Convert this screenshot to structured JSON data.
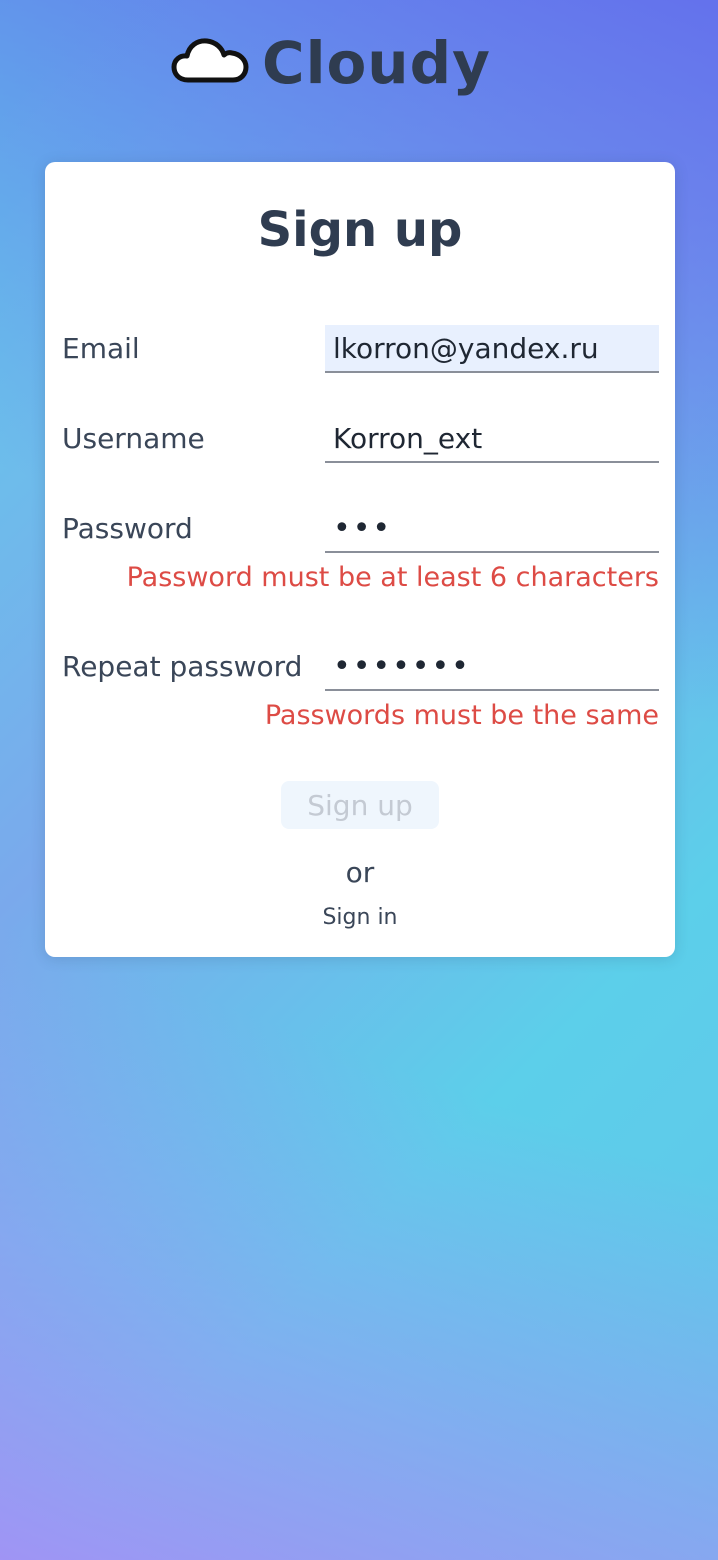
{
  "brand": {
    "name": "Cloudy",
    "icon": "cloud-icon"
  },
  "form": {
    "title": "Sign up",
    "fields": {
      "email": {
        "label": "Email",
        "value": "lkorron@yandex.ru"
      },
      "username": {
        "label": "Username",
        "value": "Korron_ext"
      },
      "password": {
        "label": "Password",
        "value": "•••",
        "error": "Password must be at least 6 characters"
      },
      "repeat_password": {
        "label": "Repeat password",
        "value": "•••••••",
        "error": "Passwords must be the same"
      }
    },
    "submit_label": "Sign up",
    "or_text": "or",
    "signin_link": "Sign in"
  },
  "colors": {
    "error": "#dd4b45",
    "text_dark": "#2f3c50",
    "button_disabled_bg": "#eff6fd"
  }
}
